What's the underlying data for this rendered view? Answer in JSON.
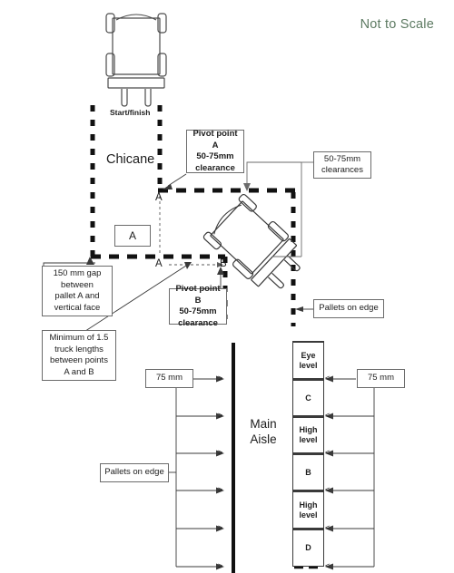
{
  "meta": {
    "not_to_scale": "Not to Scale",
    "chicane_label": "Chicane",
    "main_aisle_label": "Main\nAisle",
    "start_finish": "Start/finish",
    "point_a_upper": "A",
    "point_a_lower": "A",
    "point_b": "B",
    "pallet_a_box": "A"
  },
  "callouts": {
    "pivot_a": "Pivot point A\n50-75mm\nclearance",
    "pivot_b": "Pivot point B\n50-75mm\nclearance",
    "clearances": "50-75mm\nclearances",
    "gap_150": "150 mm gap\nbetween\npallet A and\nvertical face",
    "truck_lengths": "Minimum of 1.5\ntruck lengths\nbetween points\nA and B",
    "pallets_on_edge_right": "Pallets on edge",
    "pallets_on_edge_left": "Pallets on edge",
    "dim_left_75": "75 mm",
    "dim_right_75": "75 mm"
  },
  "rack": {
    "cells": [
      {
        "label": "Eye\nlevel"
      },
      {
        "label": "C"
      },
      {
        "label": "High\nlevel"
      },
      {
        "label": "B"
      },
      {
        "label": "High\nlevel"
      },
      {
        "label": "D"
      }
    ]
  },
  "colors": {
    "not_to_scale": "#5d7a62",
    "dash_black": "#111111",
    "line_gray": "#6b6b6b",
    "aisle_bar": "#111111",
    "truck_outline": "#4a4a4a"
  }
}
